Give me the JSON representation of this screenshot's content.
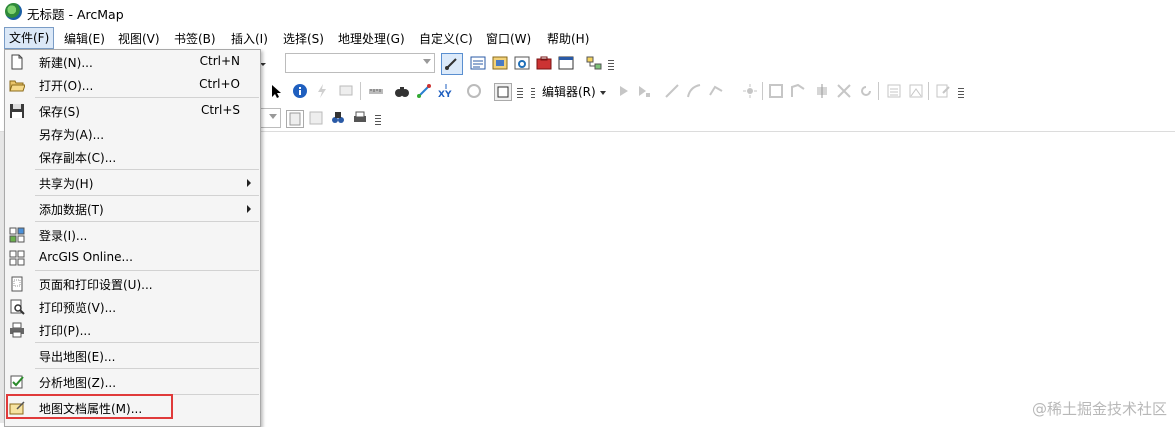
{
  "window": {
    "title": "无标题 - ArcMap",
    "icon": "arcmap-globe-icon"
  },
  "menubar": {
    "items": [
      {
        "label": "文件(F)"
      },
      {
        "label": "编辑(E)"
      },
      {
        "label": "视图(V)"
      },
      {
        "label": "书签(B)"
      },
      {
        "label": "插入(I)"
      },
      {
        "label": "选择(S)"
      },
      {
        "label": "地理处理(G)"
      },
      {
        "label": "自定义(C)"
      },
      {
        "label": "窗口(W)"
      },
      {
        "label": "帮助(H)"
      }
    ]
  },
  "toolbar": {
    "editor_label": "编辑器(R)"
  },
  "file_menu": {
    "items": [
      {
        "label": "新建(N)...",
        "shortcut": "Ctrl+N",
        "icon": "new-document-icon"
      },
      {
        "label": "打开(O)...",
        "shortcut": "Ctrl+O",
        "icon": "open-folder-icon"
      },
      {
        "label": "保存(S)",
        "shortcut": "Ctrl+S",
        "icon": "save-disk-icon"
      },
      {
        "label": "另存为(A)...",
        "shortcut": "",
        "icon": ""
      },
      {
        "label": "保存副本(C)...",
        "shortcut": "",
        "icon": ""
      },
      {
        "label": "共享为(H)",
        "shortcut": "",
        "icon": "",
        "submenu": true
      },
      {
        "label": "添加数据(T)",
        "shortcut": "",
        "icon": "",
        "submenu": true
      },
      {
        "label": "登录(I)...",
        "shortcut": "",
        "icon": "sign-in-icon"
      },
      {
        "label": "ArcGIS Online...",
        "shortcut": "",
        "icon": "arcgis-online-grid-icon"
      },
      {
        "label": "页面和打印设置(U)...",
        "shortcut": "",
        "icon": "page-setup-icon"
      },
      {
        "label": "打印预览(V)...",
        "shortcut": "",
        "icon": "print-preview-icon"
      },
      {
        "label": "打印(P)...",
        "shortcut": "",
        "icon": "printer-icon"
      },
      {
        "label": "导出地图(E)...",
        "shortcut": "",
        "icon": ""
      },
      {
        "label": "分析地图(Z)...",
        "shortcut": "",
        "icon": "analyze-map-checklist-icon"
      },
      {
        "label": "地图文档属性(M)...",
        "shortcut": "",
        "icon": "map-document-properties-icon"
      }
    ]
  },
  "colors": {
    "highlight_box": "#e03a3a",
    "menu_active_bg": "#dbe8f7"
  },
  "watermark": "@稀土掘金技术社区"
}
